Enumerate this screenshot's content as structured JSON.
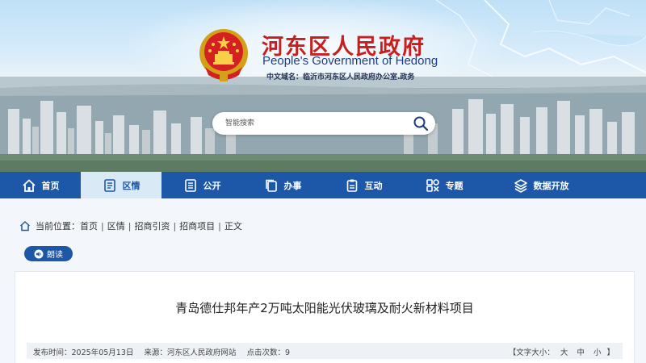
{
  "header": {
    "site_title": "河东区人民政府",
    "site_title_en": "People's Government of Hedong",
    "domain_line": "中文域名：临沂市河东区人民政府办公室.政务"
  },
  "search": {
    "placeholder": "智能搜索"
  },
  "nav": {
    "items": [
      {
        "label": "首页",
        "icon": "home-icon"
      },
      {
        "label": "区情",
        "icon": "document-icon",
        "active": true
      },
      {
        "label": "公开",
        "icon": "list-icon"
      },
      {
        "label": "办事",
        "icon": "copy-icon"
      },
      {
        "label": "互动",
        "icon": "clipboard-icon"
      },
      {
        "label": "专题",
        "icon": "topic-icon"
      },
      {
        "label": "数据开放",
        "icon": "layers-icon"
      }
    ]
  },
  "breadcrumb": {
    "label": "当前位置：",
    "items": [
      "首页",
      "区情",
      "招商引资",
      "招商项目",
      "正文"
    ]
  },
  "read_button": {
    "label": "朗读"
  },
  "article": {
    "title": "青岛德仕邦年产2万吨太阳能光伏玻璃及耐火新材料项目",
    "publish_label": "发布时间：",
    "publish_date": "2025年05月13日",
    "source_label": "来源：",
    "source": "河东区人民政府网站",
    "clicks_label": "点击次数：",
    "clicks": "9",
    "font_size_open": "【文字大小：",
    "font_large": "大",
    "font_medium": "中",
    "font_small": "小",
    "font_size_close": "】"
  },
  "colors": {
    "nav_bg": "#1c57a8",
    "nav_active_bg": "#d9e9f6",
    "title_red": "#c81e1e"
  }
}
